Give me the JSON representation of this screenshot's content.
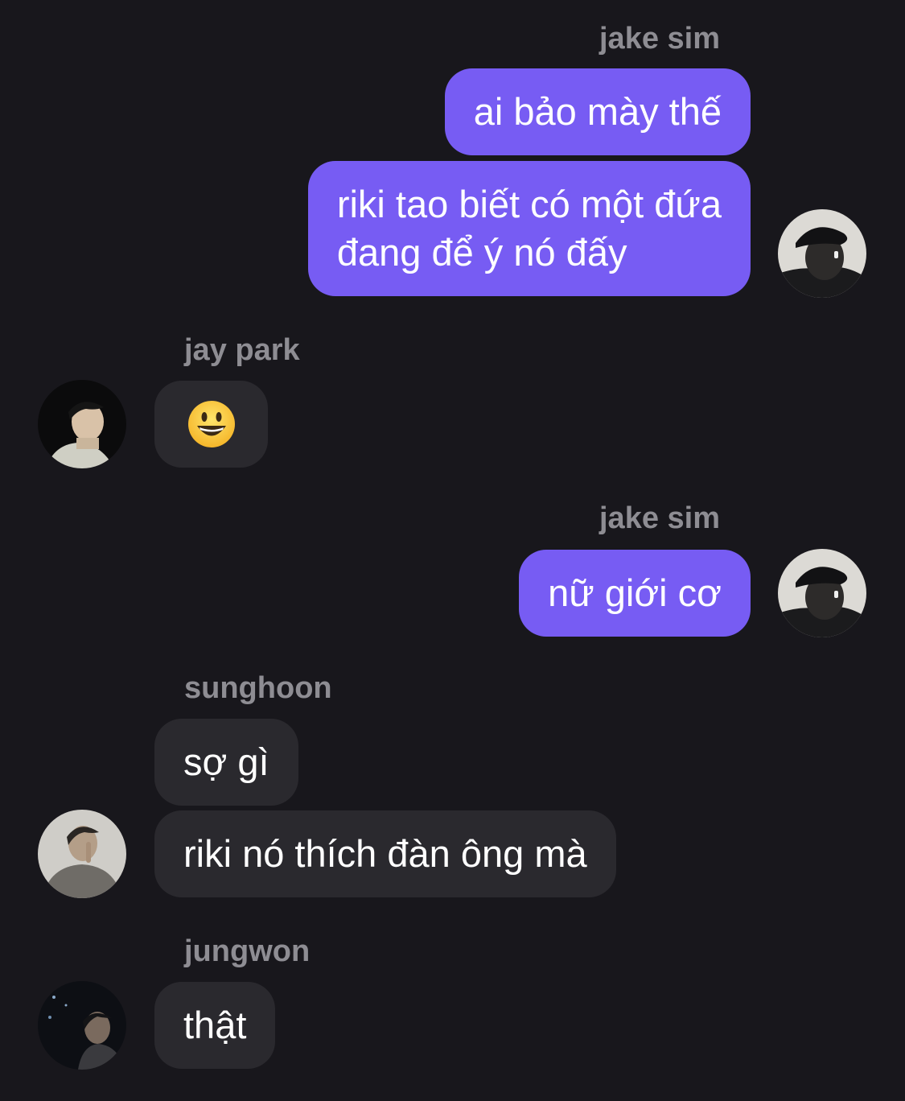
{
  "messages": [
    {
      "sender": "jake sim",
      "text": "ai bảo mày thế"
    },
    {
      "sender": "jake sim",
      "text_line1": "riki tao biết có một đứa",
      "text_line2": "đang để ý nó đấy"
    },
    {
      "sender": "jay park",
      "emoji": "smiling-face-emoji"
    },
    {
      "sender": "jake sim",
      "text": "nữ giới cơ"
    },
    {
      "sender": "sunghoon",
      "text": "sợ gì"
    },
    {
      "sender": "sunghoon",
      "text": "riki nó thích đàn ông mà"
    },
    {
      "sender": "jungwon",
      "text": "thật"
    }
  ],
  "names": {
    "jake_1": "jake sim",
    "jay": "jay park",
    "jake_2": "jake sim",
    "sunghoon": "sunghoon",
    "jungwon": "jungwon"
  },
  "colors": {
    "background": "#18171c",
    "outgoing_bubble": "#775cf3",
    "incoming_bubble": "#2a292e",
    "sender_name": "#8e8d93",
    "text": "#ffffff"
  }
}
